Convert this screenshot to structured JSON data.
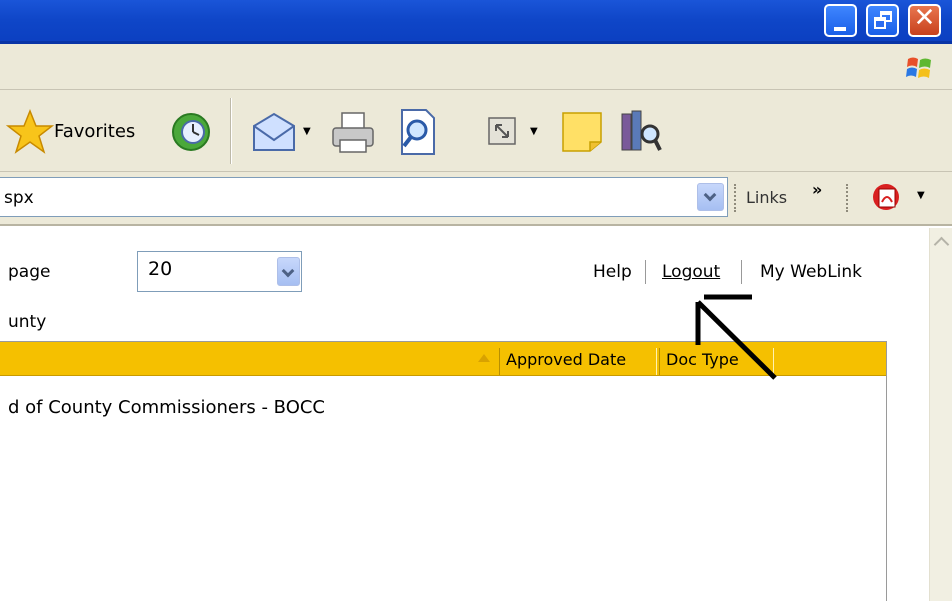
{
  "toolbar": {
    "favorites_label": "Favorites"
  },
  "address": {
    "value": "spx"
  },
  "links_bar": {
    "label": "Links",
    "more": "»"
  },
  "page": {
    "per_page_label": "page",
    "per_page_value": "20",
    "county_label": "unty",
    "help": "Help",
    "logout": "Logout",
    "my_weblink": "My WebLink"
  },
  "grid": {
    "columns": [
      "Approved Date",
      "Doc Type"
    ],
    "rows": [
      "d of County Commissioners - BOCC"
    ]
  },
  "colors": {
    "title_blue": "#0f46c8",
    "chrome_beige": "#ece9d8",
    "header_gold": "#f5c000"
  },
  "icons": [
    "minimize-icon",
    "maximize-icon",
    "close-icon",
    "windows-flag-icon",
    "favorites-star-icon",
    "history-icon",
    "mail-icon",
    "print-icon",
    "edit-icon",
    "fullscreen-icon",
    "sticky-note-icon",
    "research-icon",
    "pdf-icon"
  ]
}
